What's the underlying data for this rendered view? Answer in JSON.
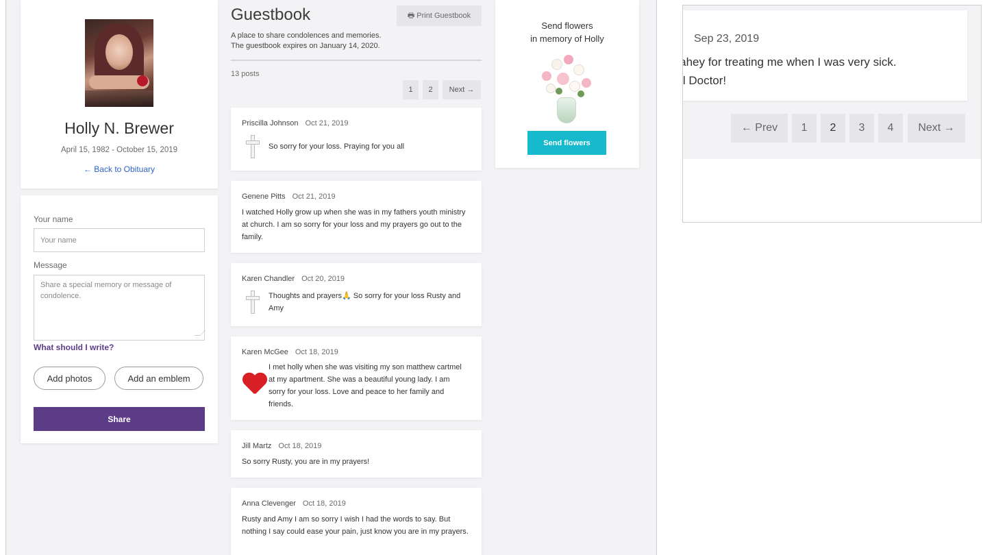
{
  "profile": {
    "name": "Holly N. Brewer",
    "dates": "April 15, 1982 - October 15, 2019",
    "back_link": "← Back to Obituary"
  },
  "form": {
    "name_label": "Your name",
    "name_placeholder": "Your name",
    "message_label": "Message",
    "message_placeholder": "Share a special memory or message of condolence.",
    "write_help": "What should I write?",
    "add_photos": "Add photos",
    "add_emblem": "Add an emblem",
    "share": "Share"
  },
  "guestbook": {
    "title": "Guestbook",
    "print_button": "🖶 Print Guestbook",
    "description_line1": "A place to share condolences and memories.",
    "description_line2": "The guestbook expires on January 14, 2020.",
    "post_count": "13 posts",
    "pager": [
      "1",
      "2",
      "Next →"
    ],
    "posts": [
      {
        "author": "Priscilla Johnson",
        "date": "Oct 21, 2019",
        "emblem": "cross-icon",
        "message": "So sorry for your loss. Praying for you all"
      },
      {
        "author": "Genene Pitts",
        "date": "Oct 21, 2019",
        "emblem": "",
        "message": "I watched Holly grow up when she was in my fathers youth ministry at church. I am so sorry for your loss and my prayers go out to the family."
      },
      {
        "author": "Karen Chandler",
        "date": "Oct 20, 2019",
        "emblem": "cross-icon",
        "message": "Thoughts and prayers🙏 So sorry for your loss Rusty and Amy"
      },
      {
        "author": "Karen McGee",
        "date": "Oct 18, 2019",
        "emblem": "heart-icon",
        "message": "I met holly when she was visiting my son matthew cartmel at my apartment. She was a beautiful young lady. I am sorry for your loss. Love and peace to her family and friends."
      },
      {
        "author": "Jill Martz",
        "date": "Oct 18, 2019",
        "emblem": "",
        "message": "So sorry Rusty, you are in my prayers!"
      },
      {
        "author": "Anna Clevenger",
        "date": "Oct 18, 2019",
        "emblem": "",
        "message": "Rusty and Amy I am so sorry I wish I had the words to say. But nothing I say could ease your pain, just know you are in my prayers."
      }
    ]
  },
  "flowers": {
    "title_line1": "Send flowers",
    "title_line2": "in memory of Holly",
    "button": "Send flowers"
  },
  "inset": {
    "date": "Sep 23, 2019",
    "line1": " Blahey for treating me when I was very sick.",
    "line2": "rful Doctor!",
    "pager": [
      "← Prev",
      "1",
      "2",
      "3",
      "4",
      "Next →"
    ],
    "active_page": "2"
  }
}
